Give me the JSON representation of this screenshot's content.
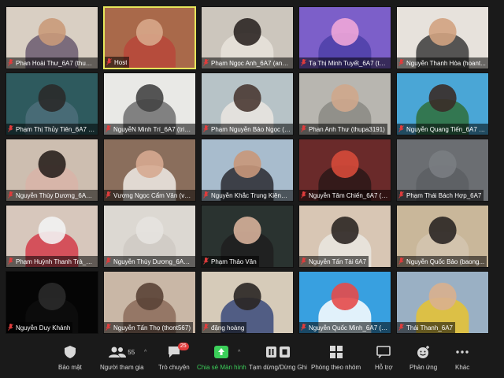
{
  "participants": [
    {
      "name": "Phan Hoài Thư_6A7 (thuph...",
      "muted": true,
      "bg": "#d9cfc3",
      "skin": "#c99a7a",
      "shirt": "#6a5a70"
    },
    {
      "name": "Host",
      "muted": true,
      "bg": "#a9694a",
      "skin": "#d7a78a",
      "shirt": "#b9483a",
      "active": true
    },
    {
      "name": "Phạm Ngọc Anh_6A7 (anhp...",
      "muted": true,
      "bg": "#ccc6bd",
      "skin": "#2c2623",
      "shirt": "#e8e3dc"
    },
    {
      "name": "Tạ Thị Minh Tuyết_6A7 (tuy...",
      "muted": true,
      "bg": "#7c5fc9",
      "skin": "#f0a6d8",
      "shirt": "#4e3fa8"
    },
    {
      "name": "Nguyễn Thanh Hòa (hoant...",
      "muted": true,
      "bg": "#e7e2dc",
      "skin": "#d2a381",
      "shirt": "#3b3b3b"
    },
    {
      "name": "Phạm Thị Thủy Tiên_6A7 (ti...",
      "muted": true,
      "bg": "#2e5a5e",
      "skin": "#2a2a2a",
      "shirt": "#4c6f7a"
    },
    {
      "name": "NguyễN Minh Trí_6A7 (trin...",
      "muted": true,
      "bg": "#e9e9e6",
      "skin": "#444444",
      "shirt": "#6e6e6e"
    },
    {
      "name": "Phạm Nguyễn Bảo Ngọc (n...",
      "muted": true,
      "bg": "#b7c3c7",
      "skin": "#4a3a33",
      "shirt": "#ebe6e0"
    },
    {
      "name": "Phan Anh Thư (thupa3191)",
      "muted": true,
      "bg": "#b8b6b0",
      "skin": "#cfa78c",
      "shirt": "#8a8a84"
    },
    {
      "name": "Nguyễn Quang Tiến_6A7 (ti...",
      "muted": true,
      "bg": "#4aa6d6",
      "skin": "#3a2c28",
      "shirt": "#2f6e3a"
    },
    {
      "name": "Nguyễn Thùy Dương_6A7 (ti...",
      "muted": true,
      "bg": "#cdbeb0",
      "skin": "#2a211e",
      "shirt": "#d8b4a8"
    },
    {
      "name": "Vương Ngọc Cẩm Vân (van...",
      "muted": true,
      "bg": "#8a6e5c",
      "skin": "#d6a990",
      "shirt": "#f0ece6"
    },
    {
      "name": "Nguyễn Khắc Trung Kiên_6...",
      "muted": true,
      "bg": "#a8bccd",
      "skin": "#c8977a",
      "shirt": "#2a2a30"
    },
    {
      "name": "Nguyễn Tâm Chiến_6A7 (ch...",
      "muted": true,
      "bg": "#6a2a2a",
      "skin": "#d64a3a",
      "shirt": "#2a1818"
    },
    {
      "name": "Phạm Thái Bách Hợp_6A7",
      "muted": true,
      "bg": "#6b6e72",
      "skin": "#7a7d82",
      "shirt": "#5c5f63"
    },
    {
      "name": "Phạm Huỳnh Thanh Trà_6A...",
      "muted": true,
      "bg": "#d7c7bc",
      "skin": "#f2f2f2",
      "shirt": "#d43c4a"
    },
    {
      "name": "Nguyễn Thùy Dương_6A7 (ti...",
      "muted": true,
      "bg": "#dcd8d2",
      "skin": "#e6e3df",
      "shirt": "#cfcac4"
    },
    {
      "name": "Phạm Thảo Vân",
      "muted": true,
      "bg": "#2a3330",
      "skin": "#d6b09a",
      "shirt": "#1e1e1e"
    },
    {
      "name": "Nguyễn Tấn Tài 6A7",
      "muted": true,
      "bg": "#d8c6b4",
      "skin": "#2c2622",
      "shirt": "#eae6e0"
    },
    {
      "name": "Nguyễn Quốc Bảo (baong...",
      "muted": true,
      "bg": "#c9b79a",
      "skin": "#2a2624",
      "shirt": "#d4c6b0"
    },
    {
      "name": "Nguyễn Duy Khánh",
      "muted": true,
      "bg": "#050505",
      "skin": "#2a2a2a",
      "shirt": "#0e0e0e"
    },
    {
      "name": "Nguyễn Tấn Thọ (thont567)",
      "muted": true,
      "bg": "#c9b7a6",
      "skin": "#5a4236",
      "shirt": "#8c6c5a"
    },
    {
      "name": "đặng hoàng",
      "muted": true,
      "bg": "#d6cbb9",
      "skin": "#2a2624",
      "shirt": "#3a4a7a"
    },
    {
      "name": "Nguyễn Quốc Minh_6A7 (mi...",
      "muted": true,
      "bg": "#38a0e0",
      "skin": "#e64a4a",
      "shirt": "#ffffff"
    },
    {
      "name": "Thái Thanh_6A7",
      "muted": true,
      "bg": "#9ab0c4",
      "skin": "#d9b08e",
      "shirt": "#e8c330"
    }
  ],
  "toolbar": {
    "security": "Bảo mật",
    "participants": "Người tham gia",
    "participants_count": "55",
    "chat": "Trò chuyện",
    "chat_badge": "25",
    "share": "Chia sẻ Màn hình",
    "pause": "Tạm dừng/Dừng Ghi",
    "breakout": "Phòng theo nhóm",
    "support": "Hỗ trợ",
    "reactions": "Phản ứng",
    "more": "Khác"
  },
  "colors": {
    "active_border": "#e6e65a",
    "muted_mic": "#e03c3c",
    "share_green": "#3ccf5a",
    "toolbar_bg": "#1a1a1a"
  }
}
